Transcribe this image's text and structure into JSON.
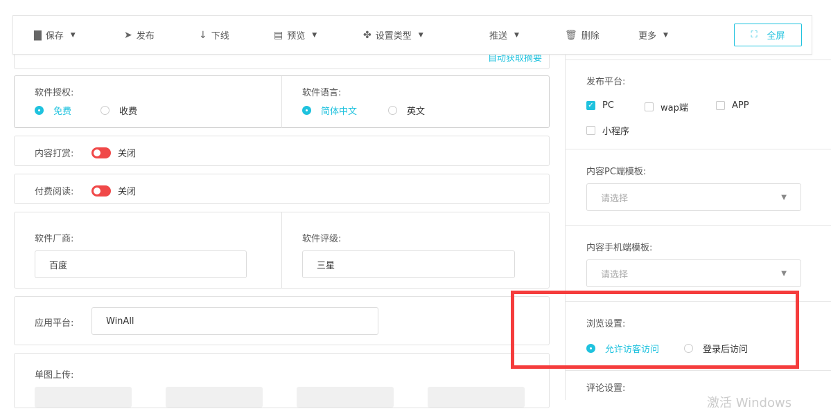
{
  "toolbar": {
    "save": "保存",
    "publish": "发布",
    "offline": "下线",
    "preview": "预览",
    "set_type": "设置类型",
    "push": "推送",
    "delete": "删除",
    "more": "更多",
    "fullscreen": "全屏"
  },
  "summary_link": "自动获取摘要",
  "license": {
    "label": "软件授权:",
    "options": [
      "免费",
      "收费"
    ],
    "selected": 0
  },
  "language": {
    "label": "软件语言:",
    "options": [
      "简体中文",
      "英文"
    ],
    "selected": 0
  },
  "reward": {
    "label": "内容打赏:",
    "state": "关闭"
  },
  "paid_read": {
    "label": "付费阅读:",
    "state": "关闭"
  },
  "vendor": {
    "label": "软件厂商:",
    "value": "百度"
  },
  "rating": {
    "label": "软件评级:",
    "value": "三星"
  },
  "platform": {
    "label": "应用平台:",
    "value": "WinAll"
  },
  "upload": {
    "label": "单图上传:"
  },
  "right": {
    "publish_platform": {
      "label": "发布平台:",
      "options": [
        {
          "name": "PC",
          "checked": true
        },
        {
          "name": "wap端",
          "checked": false
        },
        {
          "name": "APP",
          "checked": false
        },
        {
          "name": "小程序",
          "checked": false
        }
      ]
    },
    "pc_template": {
      "label": "内容PC端模板:",
      "placeholder": "请选择"
    },
    "mobile_template": {
      "label": "内容手机端模板:",
      "placeholder": "请选择"
    },
    "browse": {
      "label": "浏览设置:",
      "options": [
        "允许访客访问",
        "登录后访问"
      ],
      "selected": 0
    },
    "comment": {
      "label": "评论设置:"
    }
  },
  "watermark": "激活 Windows",
  "colors": {
    "accent": "#1fc2de",
    "highlight": "#f53c3c",
    "toggle_off": "#f04848"
  }
}
